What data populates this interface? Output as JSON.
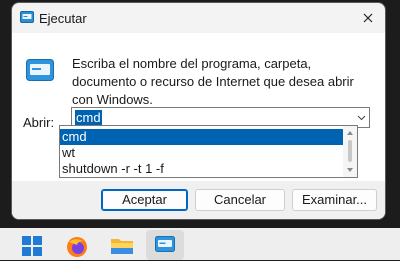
{
  "window": {
    "title": "Ejecutar",
    "icon": "run-icon",
    "close_icon": "close-icon"
  },
  "dialog": {
    "description": "Escriba el nombre del programa, carpeta, documento o recurso de Internet que desea abrir con Windows.",
    "open_label": "Abrir:",
    "input_value": "cmd",
    "dropdown_options": [
      "cmd",
      "wt",
      "shutdown -r -t 1 -f"
    ],
    "selected_option": "cmd"
  },
  "buttons": {
    "accept": "Aceptar",
    "cancel": "Cancelar",
    "browse": "Examinar..."
  },
  "taskbar": {
    "items": [
      "windows-start-icon",
      "firefox-icon",
      "file-explorer-icon",
      "run-icon"
    ]
  },
  "colors": {
    "accent": "#0063b1",
    "primary_button_border": "#0067c0"
  }
}
